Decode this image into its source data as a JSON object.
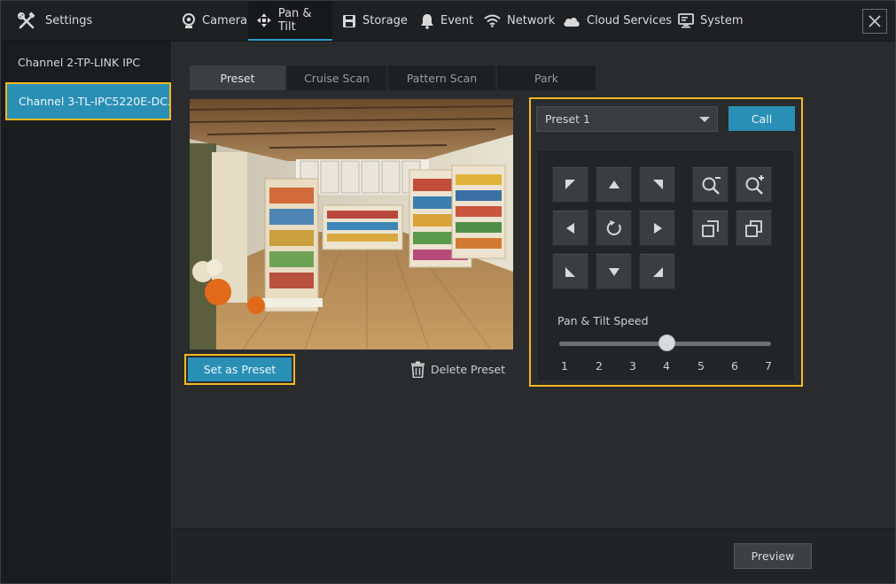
{
  "topbar": {
    "settings_label": "Settings",
    "tabs": [
      {
        "label": "Camera",
        "icon": "camera-icon"
      },
      {
        "label": "Pan & Tilt",
        "icon": "pan-tilt-icon",
        "active": true
      },
      {
        "label": "Storage",
        "icon": "save-icon"
      },
      {
        "label": "Event",
        "icon": "bell-icon"
      },
      {
        "label": "Network",
        "icon": "wifi-icon"
      },
      {
        "label": "Cloud Services",
        "icon": "cloud-icon"
      },
      {
        "label": "System",
        "icon": "monitor-icon"
      }
    ]
  },
  "sidebar": {
    "items": [
      {
        "label": "Channel 2-TP-LINK IPC"
      },
      {
        "label": "Channel 3-TL-IPC5220E-DC...",
        "selected": true
      }
    ]
  },
  "subtabs": [
    {
      "label": "Preset",
      "active": true
    },
    {
      "label": "Cruise Scan"
    },
    {
      "label": "Pattern Scan"
    },
    {
      "label": "Park"
    }
  ],
  "actions": {
    "set_preset": "Set as Preset",
    "delete_preset": "Delete Preset"
  },
  "ptz": {
    "preset_value": "Preset 1",
    "call_label": "Call",
    "speed_label": "Pan & Tilt Speed",
    "speed_ticks": [
      "1",
      "2",
      "3",
      "4",
      "5",
      "6",
      "7"
    ],
    "speed_value": 4
  },
  "footer": {
    "preview_label": "Preview"
  },
  "colors": {
    "accent": "#2a8fb5",
    "highlight": "#f3b822"
  }
}
